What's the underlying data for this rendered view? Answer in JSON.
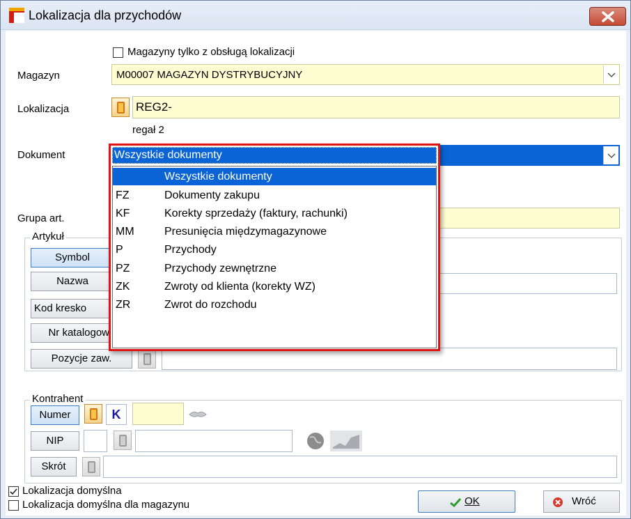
{
  "window": {
    "title": "Lokalizacja dla przychodów"
  },
  "filters": {
    "only_with_localization_label": "Magazyny tylko z obsługą lokalizacji"
  },
  "magazyn": {
    "label": "Magazyn",
    "value": "M00007 MAGAZYN DYSTRYBUCYJNY"
  },
  "lokalizacja": {
    "label": "Lokalizacja",
    "value": "REG2-",
    "description": "regał 2"
  },
  "dokument": {
    "label": "Dokument",
    "value": "Wszystkie dokumenty",
    "options": [
      {
        "code": "",
        "name": "Wszystkie dokumenty",
        "selected": true
      },
      {
        "code": "FZ",
        "name": "Dokumenty zakupu"
      },
      {
        "code": "KF",
        "name": "Korekty sprzedaży (faktury, rachunki)"
      },
      {
        "code": "MM",
        "name": "Presunięcia międzymagazynowe"
      },
      {
        "code": "P",
        "name": "Przychody"
      },
      {
        "code": "PZ",
        "name": "Przychody zewnętrzne"
      },
      {
        "code": "ZK",
        "name": "Zwroty od klienta (korekty WZ)"
      },
      {
        "code": "ZR",
        "name": "Zwrot do rozchodu"
      }
    ]
  },
  "grupa": {
    "label": "Grupa art."
  },
  "artykul": {
    "group_title": "Artykuł",
    "buttons": {
      "symbol": "Symbol",
      "nazwa": "Nazwa",
      "kod": "Kod kresko",
      "katalog": "Nr katalogowy",
      "pozycje": "Pozycje zaw."
    }
  },
  "kontrahent": {
    "group_title": "Kontrahent",
    "buttons": {
      "numer": "Numer",
      "nip": "NIP",
      "skrot": "Skrót"
    },
    "k_label": "K"
  },
  "options": {
    "default_localization_label": "Lokalizacja domyślna",
    "default_localization_checked": true,
    "default_for_warehouse_label": "Lokalizacja domyślna dla magazynu",
    "default_for_warehouse_checked": false
  },
  "actions": {
    "ok_label": "OK",
    "back_label": "Wróć"
  },
  "colors": {
    "accent": "#0a64d6",
    "highlight_border": "#e01414",
    "field_bg": "#fffed2"
  }
}
